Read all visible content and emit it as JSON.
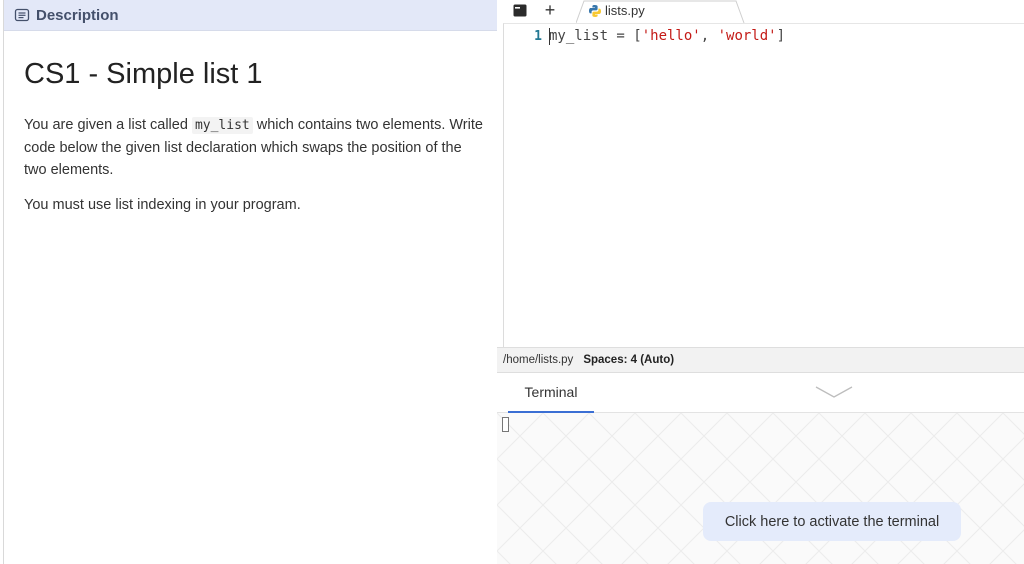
{
  "description_panel": {
    "header_label": "Description",
    "title": "CS1 - Simple list 1",
    "paragraph1": {
      "before": "You are given a list called ",
      "code": "my_list",
      "after": " which contains two elements. Write code below the given list declaration which swaps the position of the two elements."
    },
    "paragraph2": "You must use list indexing in your program."
  },
  "editor": {
    "tabs": [
      {
        "name": "lists.py",
        "icon": "python-icon",
        "active": true
      }
    ],
    "add_tab_label": "+",
    "lines": [
      {
        "number": "1",
        "tokens": [
          {
            "text": "my_list = [",
            "type": "plain"
          },
          {
            "text": "'hello'",
            "type": "str"
          },
          {
            "text": ", ",
            "type": "plain"
          },
          {
            "text": "'world'",
            "type": "str"
          },
          {
            "text": "]",
            "type": "plain"
          }
        ]
      }
    ]
  },
  "statusbar": {
    "path": "/home/lists.py",
    "spaces": "Spaces: 4 (Auto)"
  },
  "terminal": {
    "tab_label": "Terminal",
    "activate_label": "Click here to activate the terminal"
  },
  "colors": {
    "header_bg": "#e3e8f8",
    "accent": "#3b6fd4",
    "string": "#c41a16",
    "line_number": "#237893",
    "activate_bg": "#e4ebfb"
  }
}
